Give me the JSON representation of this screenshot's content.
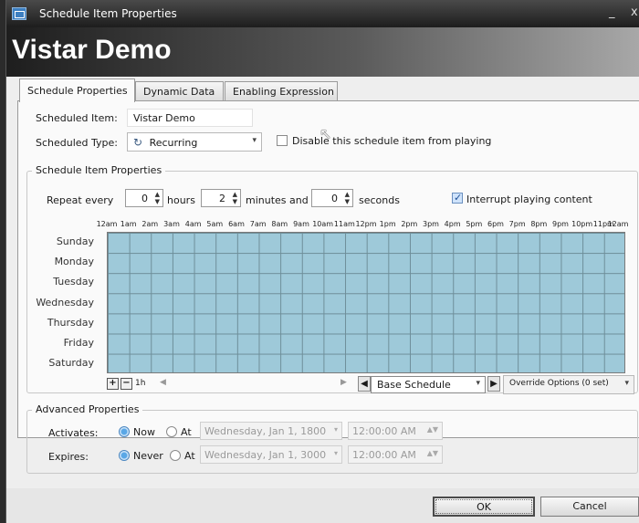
{
  "window": {
    "title": "Schedule Item Properties",
    "minimize": "_",
    "close": "x"
  },
  "banner": {
    "title": "Vistar Demo"
  },
  "tabs": [
    {
      "label": "Schedule Properties",
      "active": true
    },
    {
      "label": "Dynamic Data",
      "active": false
    },
    {
      "label": "Enabling Expression",
      "active": false
    }
  ],
  "scheduled_item": {
    "label": "Scheduled Item:",
    "value": "Vistar Demo"
  },
  "scheduled_type": {
    "label": "Scheduled Type:",
    "value": "Recurring",
    "icon": "recurring-icon"
  },
  "disable": {
    "label": "Disable this schedule item from playing",
    "checked": false
  },
  "item_props": {
    "title": "Schedule Item Properties",
    "repeat_label": "Repeat every",
    "hours_value": "0",
    "hours_label": "hours",
    "minutes_value": "2",
    "minutes_label": "minutes and",
    "seconds_value": "0",
    "seconds_label": "seconds",
    "interrupt": {
      "label": "Interrupt playing content",
      "checked": true
    }
  },
  "timeline": {
    "hours": [
      "12am",
      "1am",
      "2am",
      "3am",
      "4am",
      "5am",
      "6am",
      "7am",
      "8am",
      "9am",
      "10am",
      "11am",
      "12pm",
      "1pm",
      "2pm",
      "3pm",
      "4pm",
      "5pm",
      "6pm",
      "7pm",
      "8pm",
      "9pm",
      "10pm",
      "11pm",
      "12am"
    ],
    "days": [
      "Sunday",
      "Monday",
      "Tuesday",
      "Wednesday",
      "Thursday",
      "Friday",
      "Saturday"
    ],
    "zoom_label": "1h",
    "zoom_in": "+",
    "zoom_out": "−",
    "fill_color": "#9ec9d9"
  },
  "schedule_select": {
    "value": "Base Schedule"
  },
  "override": {
    "value": "Override Options (0 set)"
  },
  "advanced": {
    "title": "Advanced Properties",
    "activates": {
      "label": "Activates:",
      "now": "Now",
      "at": "At",
      "date": "Wednesday, Jan 1, 1800",
      "time": "12:00:00 AM",
      "selected": "Now"
    },
    "expires": {
      "label": "Expires:",
      "never": "Never",
      "at": "At",
      "date": "Wednesday, Jan 1, 3000",
      "time": "12:00:00 AM",
      "selected": "Never"
    }
  },
  "buttons": {
    "ok": "OK",
    "cancel": "Cancel"
  }
}
